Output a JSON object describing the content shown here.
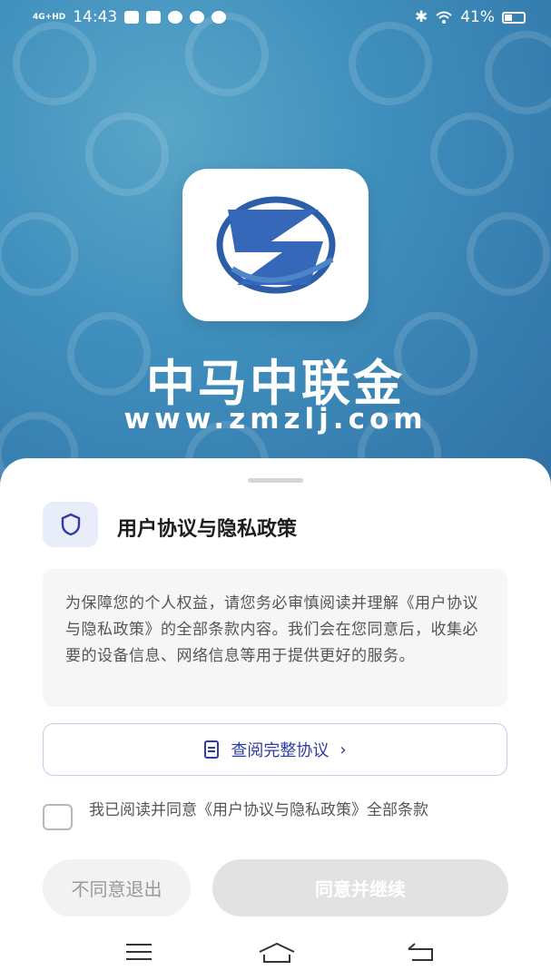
{
  "status_bar": {
    "network": "4G+HD",
    "time": "14:43",
    "battery": "41%",
    "battery_level": 0.41,
    "icons": [
      "message-icon",
      "message-icon",
      "chat-icon",
      "check-circle-icon",
      "vpn-icon",
      "bluetooth-icon",
      "wifi-icon"
    ]
  },
  "app": {
    "name": "中马中联金",
    "url": "www.zmzlj.com"
  },
  "sheet": {
    "title": "用户协议与隐私政策",
    "notice": "为保障您的个人权益，请您务必审慎阅读并理解《用户协议与隐私政策》的全部条款内容。我们会在您同意后，收集必要的设备信息、网络信息等用于提供更好的服务。",
    "view_button": "查阅完整协议",
    "checkbox_label": "我已阅读并同意《用户协议与隐私政策》全部条款",
    "checkbox_checked": false,
    "disagree_button": "不同意退出",
    "agree_button": "同意并继续"
  },
  "colors": {
    "accent": "#2f3da3",
    "hero_blue": "#3f8fbd",
    "disabled_button": "#e2e2e2"
  },
  "nav_bar": {
    "icons": [
      "menu-icon",
      "home-icon",
      "back-icon"
    ]
  }
}
